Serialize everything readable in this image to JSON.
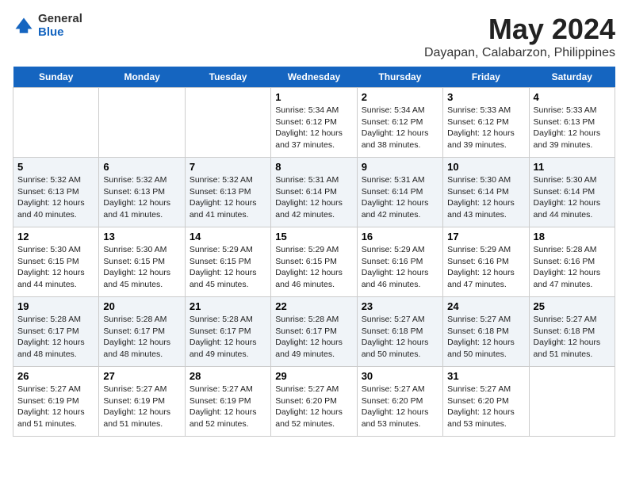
{
  "logo": {
    "general": "General",
    "blue": "Blue"
  },
  "title": "May 2024",
  "subtitle": "Dayapan, Calabarzon, Philippines",
  "days_of_week": [
    "Sunday",
    "Monday",
    "Tuesday",
    "Wednesday",
    "Thursday",
    "Friday",
    "Saturday"
  ],
  "weeks": [
    [
      {
        "day": "",
        "info": ""
      },
      {
        "day": "",
        "info": ""
      },
      {
        "day": "",
        "info": ""
      },
      {
        "day": "1",
        "info": "Sunrise: 5:34 AM\nSunset: 6:12 PM\nDaylight: 12 hours\nand 37 minutes."
      },
      {
        "day": "2",
        "info": "Sunrise: 5:34 AM\nSunset: 6:12 PM\nDaylight: 12 hours\nand 38 minutes."
      },
      {
        "day": "3",
        "info": "Sunrise: 5:33 AM\nSunset: 6:12 PM\nDaylight: 12 hours\nand 39 minutes."
      },
      {
        "day": "4",
        "info": "Sunrise: 5:33 AM\nSunset: 6:13 PM\nDaylight: 12 hours\nand 39 minutes."
      }
    ],
    [
      {
        "day": "5",
        "info": "Sunrise: 5:32 AM\nSunset: 6:13 PM\nDaylight: 12 hours\nand 40 minutes."
      },
      {
        "day": "6",
        "info": "Sunrise: 5:32 AM\nSunset: 6:13 PM\nDaylight: 12 hours\nand 41 minutes."
      },
      {
        "day": "7",
        "info": "Sunrise: 5:32 AM\nSunset: 6:13 PM\nDaylight: 12 hours\nand 41 minutes."
      },
      {
        "day": "8",
        "info": "Sunrise: 5:31 AM\nSunset: 6:14 PM\nDaylight: 12 hours\nand 42 minutes."
      },
      {
        "day": "9",
        "info": "Sunrise: 5:31 AM\nSunset: 6:14 PM\nDaylight: 12 hours\nand 42 minutes."
      },
      {
        "day": "10",
        "info": "Sunrise: 5:30 AM\nSunset: 6:14 PM\nDaylight: 12 hours\nand 43 minutes."
      },
      {
        "day": "11",
        "info": "Sunrise: 5:30 AM\nSunset: 6:14 PM\nDaylight: 12 hours\nand 44 minutes."
      }
    ],
    [
      {
        "day": "12",
        "info": "Sunrise: 5:30 AM\nSunset: 6:15 PM\nDaylight: 12 hours\nand 44 minutes."
      },
      {
        "day": "13",
        "info": "Sunrise: 5:30 AM\nSunset: 6:15 PM\nDaylight: 12 hours\nand 45 minutes."
      },
      {
        "day": "14",
        "info": "Sunrise: 5:29 AM\nSunset: 6:15 PM\nDaylight: 12 hours\nand 45 minutes."
      },
      {
        "day": "15",
        "info": "Sunrise: 5:29 AM\nSunset: 6:15 PM\nDaylight: 12 hours\nand 46 minutes."
      },
      {
        "day": "16",
        "info": "Sunrise: 5:29 AM\nSunset: 6:16 PM\nDaylight: 12 hours\nand 46 minutes."
      },
      {
        "day": "17",
        "info": "Sunrise: 5:29 AM\nSunset: 6:16 PM\nDaylight: 12 hours\nand 47 minutes."
      },
      {
        "day": "18",
        "info": "Sunrise: 5:28 AM\nSunset: 6:16 PM\nDaylight: 12 hours\nand 47 minutes."
      }
    ],
    [
      {
        "day": "19",
        "info": "Sunrise: 5:28 AM\nSunset: 6:17 PM\nDaylight: 12 hours\nand 48 minutes."
      },
      {
        "day": "20",
        "info": "Sunrise: 5:28 AM\nSunset: 6:17 PM\nDaylight: 12 hours\nand 48 minutes."
      },
      {
        "day": "21",
        "info": "Sunrise: 5:28 AM\nSunset: 6:17 PM\nDaylight: 12 hours\nand 49 minutes."
      },
      {
        "day": "22",
        "info": "Sunrise: 5:28 AM\nSunset: 6:17 PM\nDaylight: 12 hours\nand 49 minutes."
      },
      {
        "day": "23",
        "info": "Sunrise: 5:27 AM\nSunset: 6:18 PM\nDaylight: 12 hours\nand 50 minutes."
      },
      {
        "day": "24",
        "info": "Sunrise: 5:27 AM\nSunset: 6:18 PM\nDaylight: 12 hours\nand 50 minutes."
      },
      {
        "day": "25",
        "info": "Sunrise: 5:27 AM\nSunset: 6:18 PM\nDaylight: 12 hours\nand 51 minutes."
      }
    ],
    [
      {
        "day": "26",
        "info": "Sunrise: 5:27 AM\nSunset: 6:19 PM\nDaylight: 12 hours\nand 51 minutes."
      },
      {
        "day": "27",
        "info": "Sunrise: 5:27 AM\nSunset: 6:19 PM\nDaylight: 12 hours\nand 51 minutes."
      },
      {
        "day": "28",
        "info": "Sunrise: 5:27 AM\nSunset: 6:19 PM\nDaylight: 12 hours\nand 52 minutes."
      },
      {
        "day": "29",
        "info": "Sunrise: 5:27 AM\nSunset: 6:20 PM\nDaylight: 12 hours\nand 52 minutes."
      },
      {
        "day": "30",
        "info": "Sunrise: 5:27 AM\nSunset: 6:20 PM\nDaylight: 12 hours\nand 53 minutes."
      },
      {
        "day": "31",
        "info": "Sunrise: 5:27 AM\nSunset: 6:20 PM\nDaylight: 12 hours\nand 53 minutes."
      },
      {
        "day": "",
        "info": ""
      }
    ]
  ]
}
